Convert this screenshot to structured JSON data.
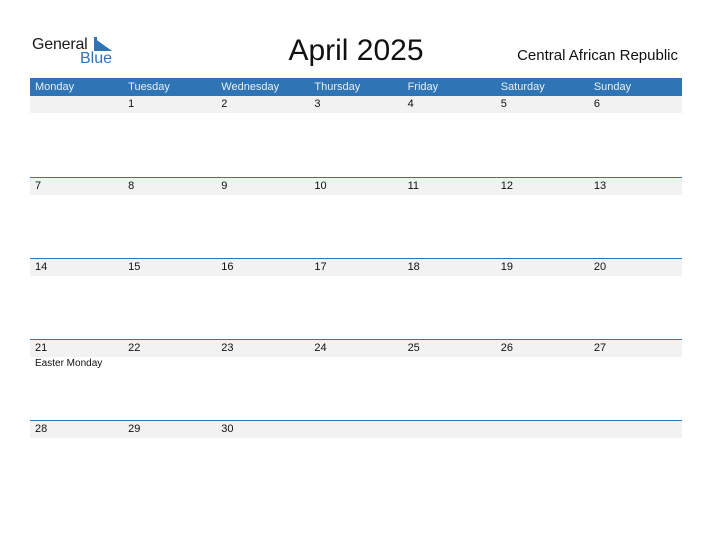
{
  "logo": {
    "word1": "General",
    "word2": "Blue"
  },
  "title": "April 2025",
  "country": "Central African Republic",
  "colors": {
    "accent": "#2f74b5",
    "strip": "#f2f2f2"
  },
  "weekdays": [
    "Monday",
    "Tuesday",
    "Wednesday",
    "Thursday",
    "Friday",
    "Saturday",
    "Sunday"
  ],
  "weeks": [
    {
      "days": [
        "",
        "1",
        "2",
        "3",
        "4",
        "5",
        "6"
      ],
      "holidays": [
        "",
        "",
        "",
        "",
        "",
        "",
        ""
      ]
    },
    {
      "days": [
        "7",
        "8",
        "9",
        "10",
        "11",
        "12",
        "13"
      ],
      "holidays": [
        "",
        "",
        "",
        "",
        "",
        "",
        ""
      ]
    },
    {
      "days": [
        "14",
        "15",
        "16",
        "17",
        "18",
        "19",
        "20"
      ],
      "holidays": [
        "",
        "",
        "",
        "",
        "",
        "",
        ""
      ]
    },
    {
      "days": [
        "21",
        "22",
        "23",
        "24",
        "25",
        "26",
        "27"
      ],
      "holidays": [
        "Easter Monday",
        "",
        "",
        "",
        "",
        "",
        ""
      ]
    },
    {
      "days": [
        "28",
        "29",
        "30",
        "",
        "",
        "",
        ""
      ],
      "holidays": [
        "",
        "",
        "",
        "",
        "",
        "",
        ""
      ]
    }
  ]
}
